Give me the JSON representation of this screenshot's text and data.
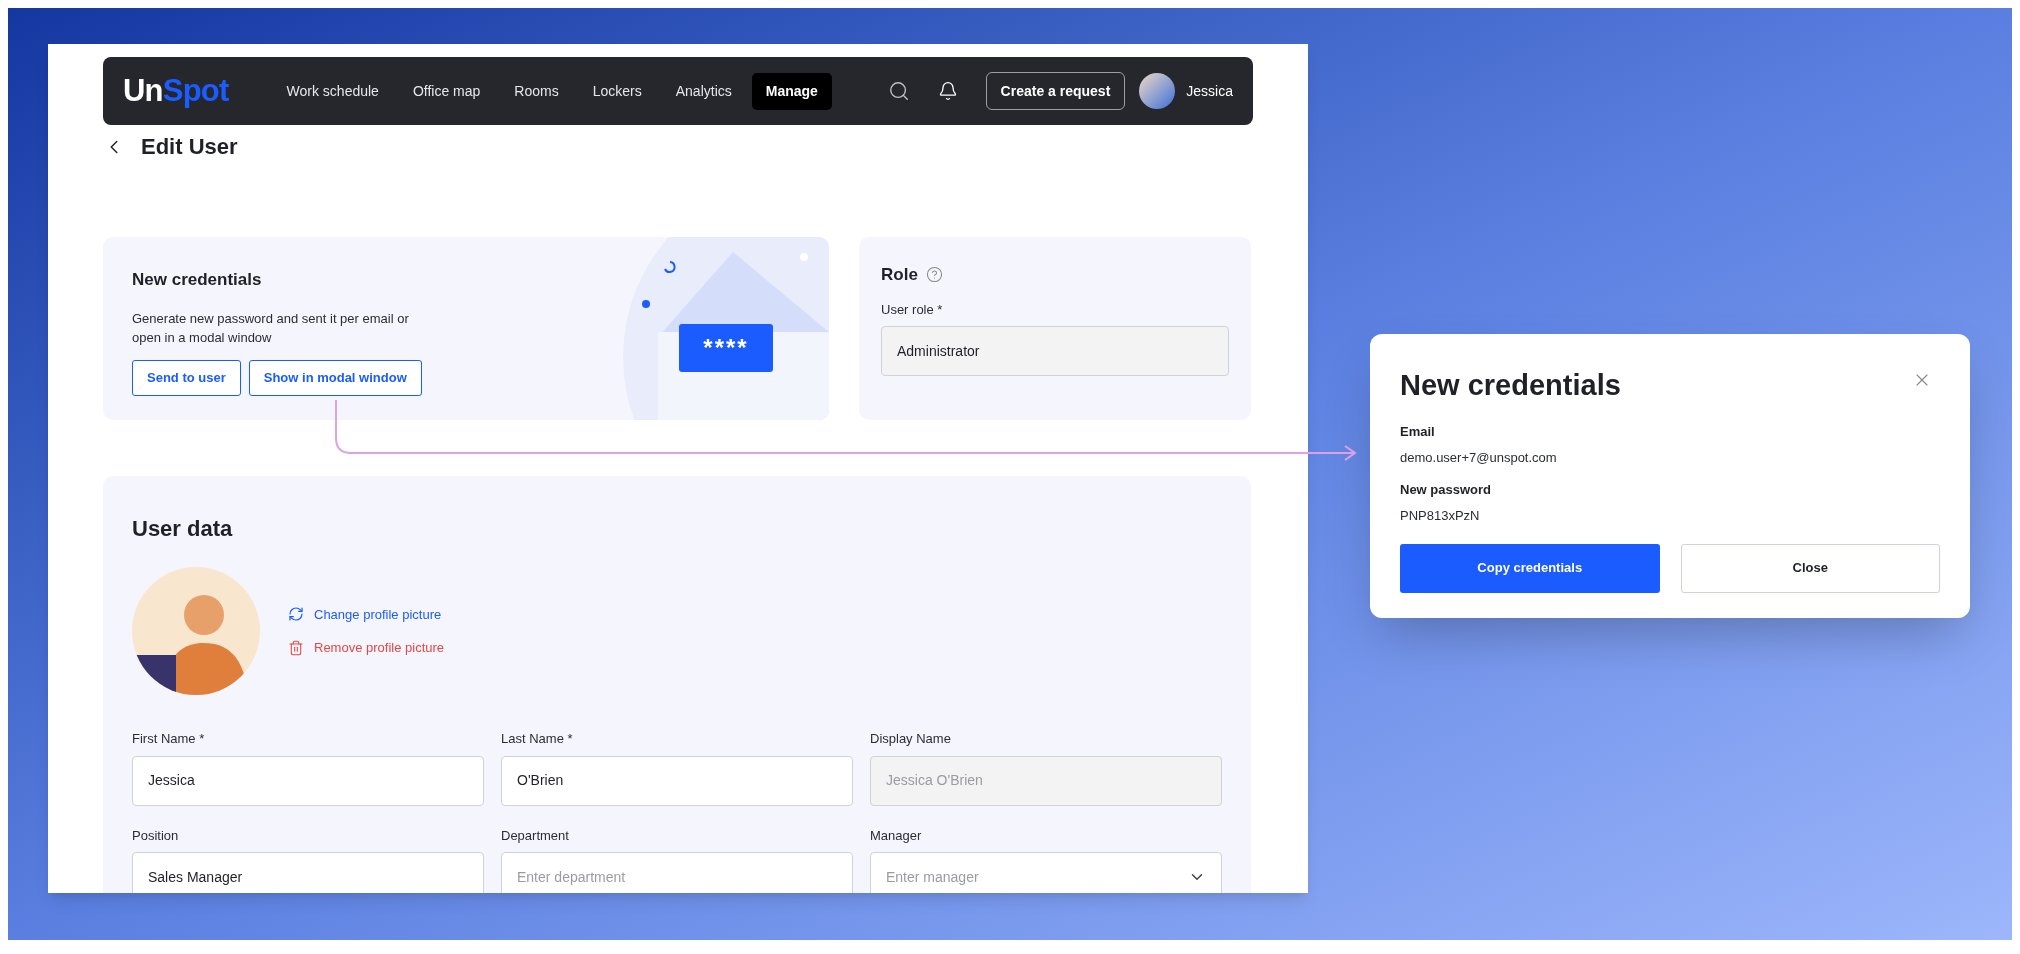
{
  "nav": {
    "logo": [
      "Un",
      "Spot"
    ],
    "items": [
      {
        "label": "Work schedule",
        "selected": false
      },
      {
        "label": "Office map",
        "selected": false
      },
      {
        "label": "Rooms",
        "selected": false
      },
      {
        "label": "Lockers",
        "selected": false
      },
      {
        "label": "Analytics",
        "selected": false
      },
      {
        "label": "Manage",
        "selected": true
      }
    ],
    "action": "Create a request",
    "user": "Jessica"
  },
  "page_title": "Edit User",
  "credentials_card": {
    "title": "New credentials",
    "description": "Generate new password and sent it per email or open in a modal window",
    "buttons": [
      "Send to user",
      "Show in modal window"
    ],
    "illustration_code": "****"
  },
  "role_card": {
    "title": "Role",
    "field": {
      "label": "User role *",
      "value": "Administrator",
      "disabled": true
    }
  },
  "user_data": {
    "title": "User data",
    "actions": [
      {
        "label": "Change profile picture",
        "kind": "change"
      },
      {
        "label": "Remove profile picture",
        "kind": "remove"
      }
    ],
    "fields": [
      {
        "label": "First Name *",
        "value": "Jessica",
        "kind": "text",
        "disabled": false
      },
      {
        "label": "Last Name *",
        "value": "O'Brien",
        "kind": "text",
        "disabled": false
      },
      {
        "label": "Display Name",
        "placeholder": "Jessica O'Brien",
        "kind": "text",
        "disabled": true
      },
      {
        "label": "Position",
        "value": "Sales Manager",
        "kind": "text",
        "disabled": false
      },
      {
        "label": "Department",
        "placeholder": "Enter department",
        "kind": "text",
        "disabled": false
      },
      {
        "label": "Manager",
        "placeholder": "Enter manager",
        "kind": "select",
        "disabled": false
      }
    ]
  },
  "modal": {
    "title": "New credentials",
    "rows": [
      {
        "label": "Email",
        "value": "demo.user+7@unspot.com"
      },
      {
        "label": "New password",
        "value": "PNP813xPzN"
      }
    ],
    "primary": "Copy credentials",
    "secondary": "Close"
  }
}
